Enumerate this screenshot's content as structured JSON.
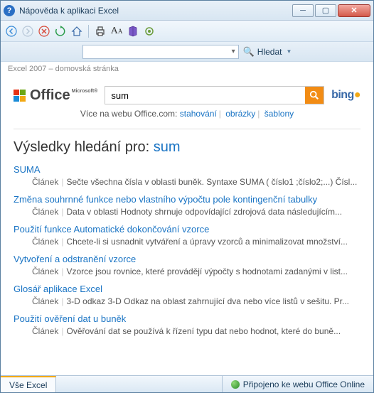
{
  "titlebar": {
    "title": "Nápověda k aplikaci Excel"
  },
  "breadcrumb": "Excel 2007 – domovská stránka",
  "searchbar": {
    "button": "Hledat"
  },
  "office": {
    "brand": "Office",
    "ms": "Microsoft®",
    "search_value": "sum",
    "bing": "bing"
  },
  "more": {
    "prefix": "Více na webu Office.com:",
    "links": [
      "stahování",
      "obrázky",
      "šablony"
    ]
  },
  "heading": {
    "prefix": "Výsledky hledání pro: ",
    "term": "sum"
  },
  "results": [
    {
      "title": "SUMA",
      "type": "Článek",
      "desc": "Sečte všechna čísla v oblasti buněk. Syntaxe SUMA ( číslo1 ;číslo2;...) Čísl..."
    },
    {
      "title": "Změna souhrnné funkce nebo vlastního výpočtu pole kontingenční tabulky",
      "type": "Článek",
      "desc": "Data v oblasti Hodnoty shrnuje odpovídající zdrojová data následujícím..."
    },
    {
      "title": "Použití funkce Automatické dokončování vzorce",
      "type": "Článek",
      "desc": "Chcete-li si usnadnit vytváření a úpravy vzorců a minimalizovat množství..."
    },
    {
      "title": "Vytvoření a odstranění vzorce",
      "type": "Článek",
      "desc": "Vzorce jsou rovnice, které provádějí výpočty s hodnotami zadanými v list..."
    },
    {
      "title": "Glosář aplikace Excel",
      "type": "Článek",
      "desc": "3-D odkaz 3-D Odkaz na oblast zahrnující dva nebo více listů v sešitu. Pr..."
    },
    {
      "title": "Použití ověření dat u buněk",
      "type": "Článek",
      "desc": "Ověřování dat se používá k řízení typu dat nebo hodnot, které do buně..."
    }
  ],
  "status": {
    "left": "Vše Excel",
    "right": "Připojeno ke webu Office Online"
  }
}
